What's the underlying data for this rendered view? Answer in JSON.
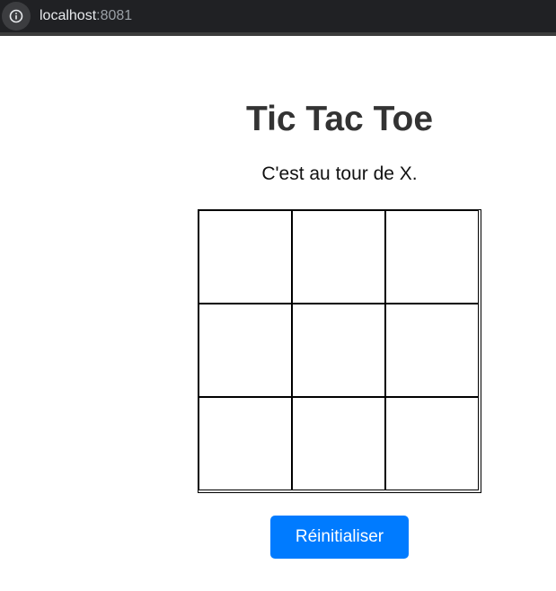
{
  "browser": {
    "host": "localhost",
    "port": ":8081"
  },
  "game": {
    "title": "Tic Tac Toe",
    "status": "C'est au tour de X.",
    "cells": [
      "",
      "",
      "",
      "",
      "",
      "",
      "",
      "",
      ""
    ],
    "reset_label": "Réinitialiser"
  },
  "colors": {
    "reset_button": "#007bff",
    "title": "#333333",
    "grid_border": "#000000"
  },
  "icons": {
    "site_info": "info-icon"
  }
}
